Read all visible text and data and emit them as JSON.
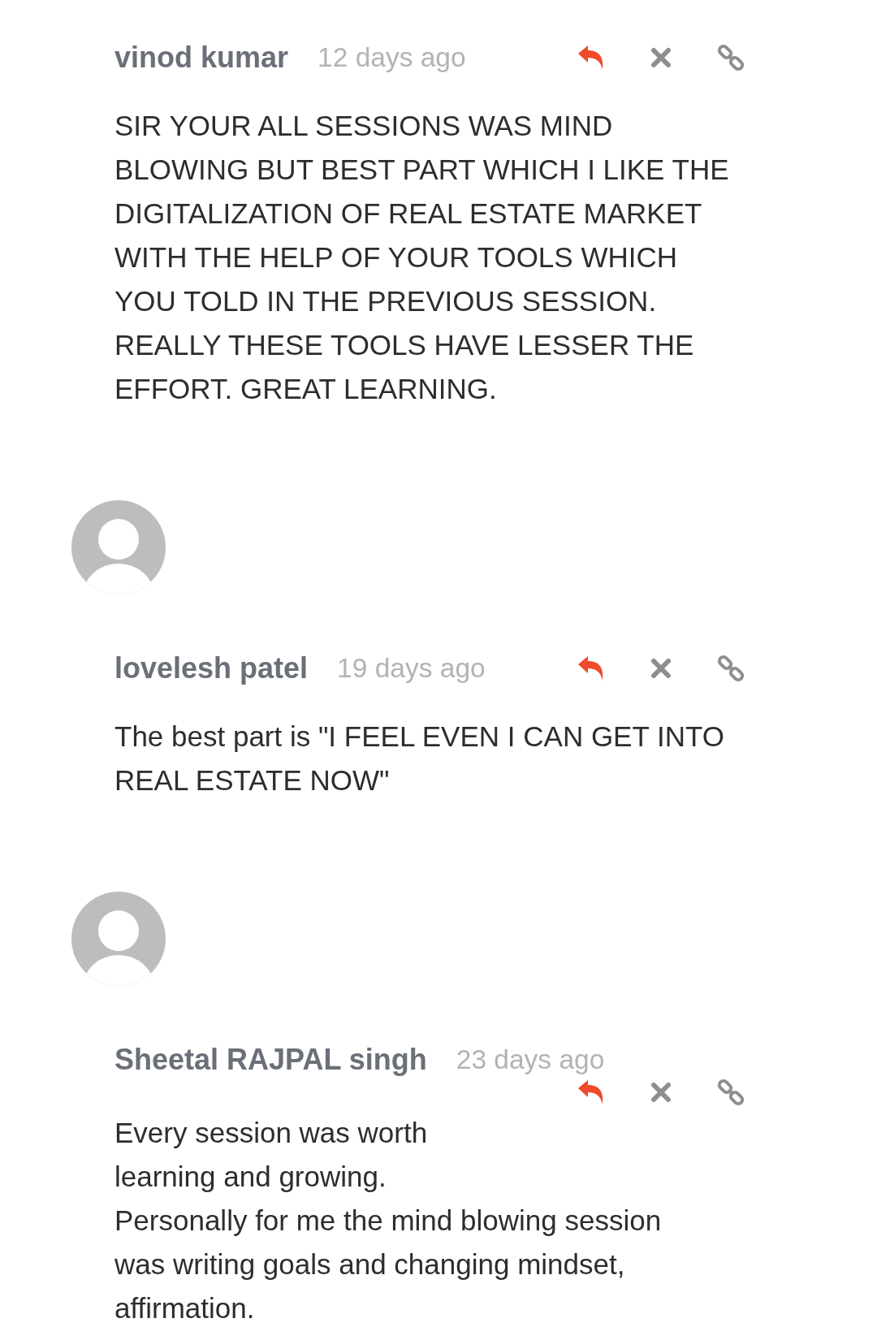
{
  "comments": [
    {
      "avatar": false,
      "author": "vinod kumar",
      "time": "12 days ago",
      "body": [
        "SIR YOUR ALL SESSIONS WAS MIND",
        "BLOWING BUT BEST PART WHICH I LIKE THE",
        "DIGITALIZATION OF REAL ESTATE MARKET",
        "WITH THE HELP OF YOUR TOOLS WHICH",
        "YOU TOLD IN THE PREVIOUS SESSION.",
        "REALLY THESE TOOLS  HAVE LESSER THE",
        "EFFORT. GREAT LEARNING."
      ]
    },
    {
      "avatar": true,
      "author": "lovelesh patel",
      "time": "19 days ago",
      "body": [
        "The best part is \"I FEEL EVEN I CAN GET INTO",
        "REAL ESTATE NOW\""
      ]
    },
    {
      "avatar": true,
      "author": "Sheetal RAJPAL singh",
      "time": "23 days ago",
      "body": [
        "Every session was worth",
        "learning and growing.",
        "Personally for me the mind blowing session",
        "was writing goals and changing mindset,",
        "affirmation."
      ]
    }
  ]
}
